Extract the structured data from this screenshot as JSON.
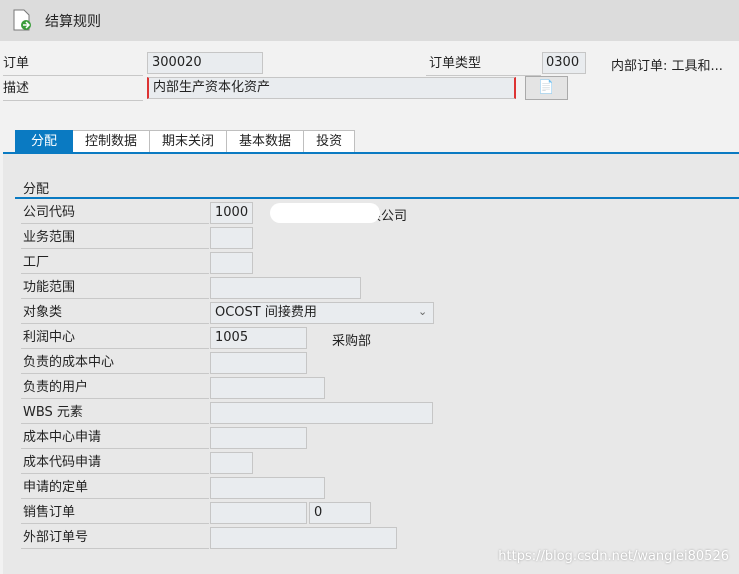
{
  "title": "结算规则",
  "header": {
    "order_label": "订单",
    "order_value": "300020",
    "order_type_label": "订单类型",
    "order_type_value": "0300",
    "order_type_desc": "内部订单: 工具和...",
    "desc_label": "描述",
    "desc_value": "内部生产资本化资产"
  },
  "tabs": [
    {
      "label": "分配",
      "active": true
    },
    {
      "label": "控制数据"
    },
    {
      "label": "期末关闭"
    },
    {
      "label": "基本数据"
    },
    {
      "label": "投资"
    }
  ],
  "section_title": "分配",
  "rows": [
    {
      "label": "公司代码",
      "value": "1000",
      "extra": "有限公司"
    },
    {
      "label": "业务范围",
      "value": ""
    },
    {
      "label": "工厂",
      "value": ""
    },
    {
      "label": "功能范围",
      "value": ""
    },
    {
      "label": "对象类",
      "value": "OCOST  间接费用"
    },
    {
      "label": "利润中心",
      "value": "1005",
      "extra": "采购部"
    },
    {
      "label": "负责的成本中心",
      "value": ""
    },
    {
      "label": "负责的用户",
      "value": ""
    },
    {
      "label": "WBS 元素",
      "value": ""
    },
    {
      "label": "成本中心申请",
      "value": ""
    },
    {
      "label": "成本代码申请",
      "value": ""
    },
    {
      "label": "申请的定单",
      "value": ""
    },
    {
      "label": "销售订单",
      "value": "",
      "value2": "0"
    },
    {
      "label": "外部订单号",
      "value": ""
    }
  ],
  "watermark": "https://blog.csdn.net/wanglei80526"
}
